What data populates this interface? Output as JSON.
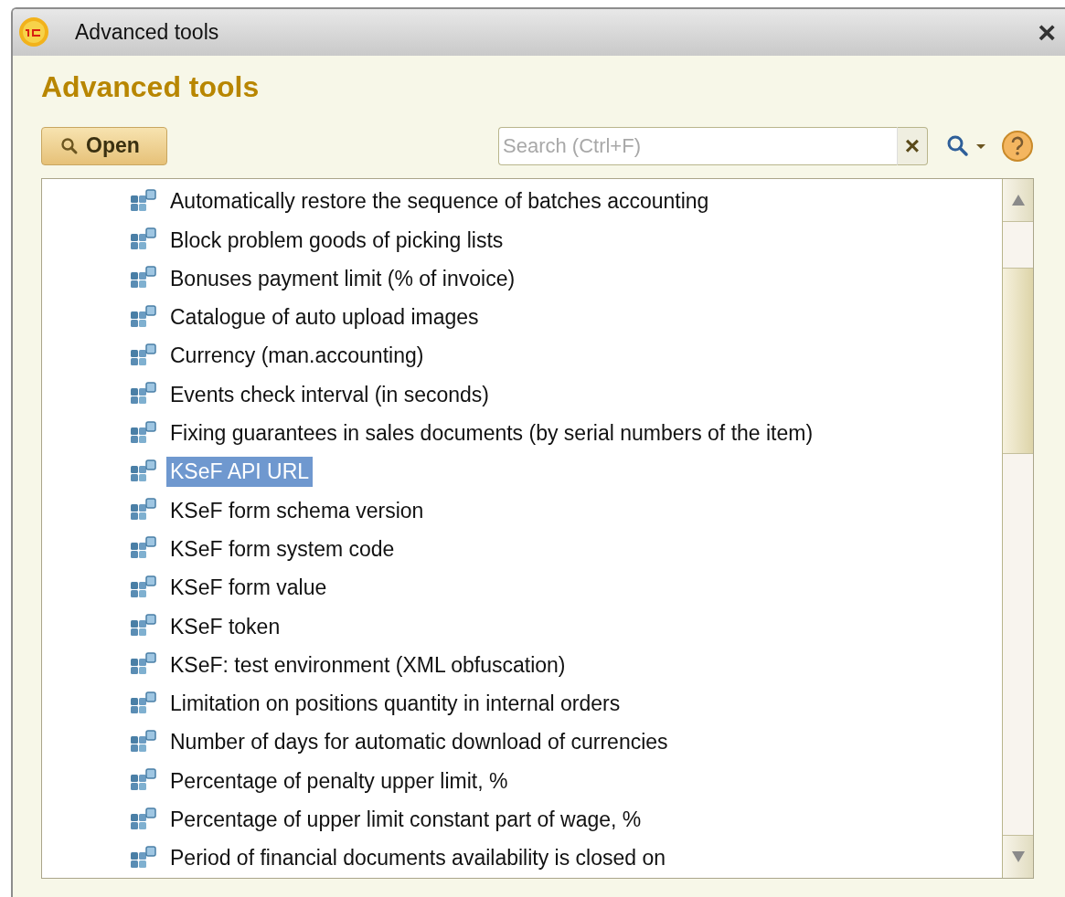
{
  "window": {
    "title": "Advanced tools",
    "close": "×"
  },
  "heading": "Advanced tools",
  "toolbar": {
    "open_button": "Open",
    "search": {
      "placeholder": "Search (Ctrl+F)",
      "clear": "×"
    }
  },
  "list": {
    "items": [
      {
        "label": "Automatically restore the sequence of batches accounting",
        "selected": false
      },
      {
        "label": "Block problem goods of picking lists",
        "selected": false
      },
      {
        "label": "Bonuses payment limit (% of invoice)",
        "selected": false
      },
      {
        "label": "Catalogue of auto upload images",
        "selected": false
      },
      {
        "label": "Currency (man.accounting)",
        "selected": false
      },
      {
        "label": "Events check interval (in seconds)",
        "selected": false
      },
      {
        "label": "Fixing guarantees in sales documents (by serial numbers of the item)",
        "selected": false
      },
      {
        "label": "KSeF API URL",
        "selected": true
      },
      {
        "label": "KSeF form schema version",
        "selected": false
      },
      {
        "label": "KSeF form system code",
        "selected": false
      },
      {
        "label": "KSeF form value",
        "selected": false
      },
      {
        "label": "KSeF token",
        "selected": false
      },
      {
        "label": "KSeF: test environment (XML obfuscation)",
        "selected": false
      },
      {
        "label": "Limitation on positions quantity in internal orders",
        "selected": false
      },
      {
        "label": "Number of days for automatic download of currencies",
        "selected": false
      },
      {
        "label": "Percentage of penalty upper limit, %",
        "selected": false
      },
      {
        "label": "Percentage of upper limit constant part of wage, %",
        "selected": false
      },
      {
        "label": "Period of financial documents availability is closed on",
        "selected": false
      }
    ]
  }
}
